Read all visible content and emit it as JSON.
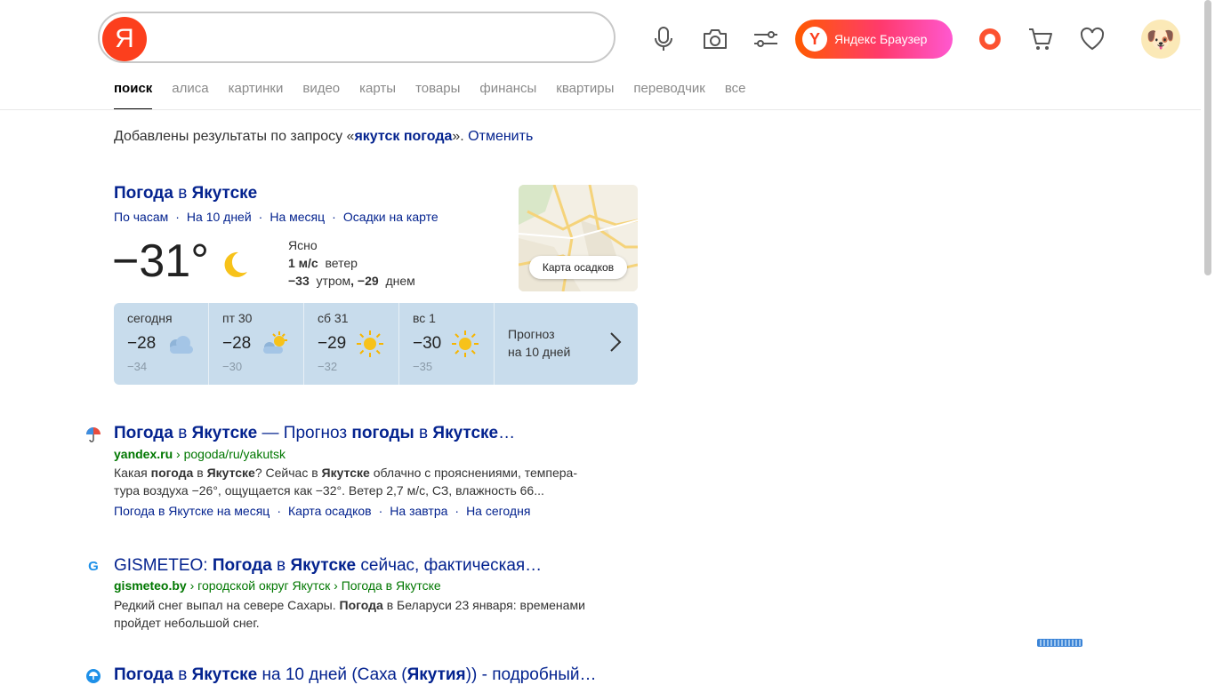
{
  "search": {
    "value": "",
    "logo_letter": "Я"
  },
  "header": {
    "browser_button": "Яндекс Браузер",
    "browser_logo": "Y",
    "icons": [
      "microphone-icon",
      "camera-icon",
      "filter-icon",
      "alice-icon",
      "cart-icon",
      "heart-icon"
    ],
    "accent": "#fc3f1d"
  },
  "nav": {
    "tabs": [
      "поиск",
      "алиса",
      "картинки",
      "видео",
      "карты",
      "товары",
      "финансы",
      "квартиры",
      "переводчик",
      "все"
    ],
    "active": 0
  },
  "notice": {
    "prefix": "Добавлены результаты по запросу «",
    "query": "якутск погода",
    "suffix": "». ",
    "cancel": "Отменить"
  },
  "weather": {
    "title_pre": "Погода",
    "title_mid": " в ",
    "title_city": "Якутске",
    "links": [
      "По часам",
      "На 10 дней",
      "На месяц",
      "Осадки на карте"
    ],
    "temp": "−31°",
    "condition": "Ясно",
    "wind_value": "1 м/с",
    "wind_label": "ветер",
    "morning": "−33",
    "morning_label": "утром",
    "day": "−29",
    "day_label": "днем",
    "map_button": "Карта осадков",
    "days": [
      {
        "label": "сегодня",
        "hi": "−28",
        "lo": "−34",
        "icon": "cloudy-icon"
      },
      {
        "label": "пт 30",
        "hi": "−28",
        "lo": "−30",
        "icon": "partly-cloudy-icon"
      },
      {
        "label": "сб 31",
        "hi": "−29",
        "lo": "−32",
        "icon": "sun-icon"
      },
      {
        "label": "вс 1",
        "hi": "−30",
        "lo": "−35",
        "icon": "sun-icon"
      }
    ],
    "forecast_link_1": "Прогноз",
    "forecast_link_2": "на 10 дней"
  },
  "results": [
    {
      "title_parts": [
        "Погода",
        " в ",
        "Якутске",
        " — Прогноз ",
        "погоды",
        " в ",
        "Якутске",
        "…"
      ],
      "domain": "yandex.ru",
      "path": " › pogoda/ru/yakutsk",
      "snippet_parts": [
        "Какая ",
        "погода",
        " в ",
        "Якутске",
        "? Сейчас в ",
        "Якутске",
        " облачно с прояснениями, темпера-"
      ],
      "snippet_line2": "тура воздуха −26°, ощущается как −32°. Ветер 2,7 м/с, СЗ, влажность 66...",
      "links": [
        "Погода в Якутске на месяц",
        "Карта осадков",
        "На завтра",
        "На сегодня"
      ]
    },
    {
      "title_parts": [
        "GISMETEO: ",
        "Погода",
        " в ",
        "Якутске",
        " сейчас, фактическая…"
      ],
      "domain": "gismeteo.by",
      "path": " › городской округ Якутск › Погода в Якутске",
      "snippet_a": "Редкий снег выпал на севере Сахары. ",
      "snippet_b": "Погода",
      "snippet_c": " в Беларуси 23 января: временами",
      "snippet_line2": "пройдет небольшой снег.",
      "favicon_letter": "G"
    },
    {
      "title_parts": [
        "Погода",
        " в ",
        "Якутске",
        " на 10 дней (Саха (",
        "Якутия",
        ")) - подробный…"
      ]
    }
  ]
}
